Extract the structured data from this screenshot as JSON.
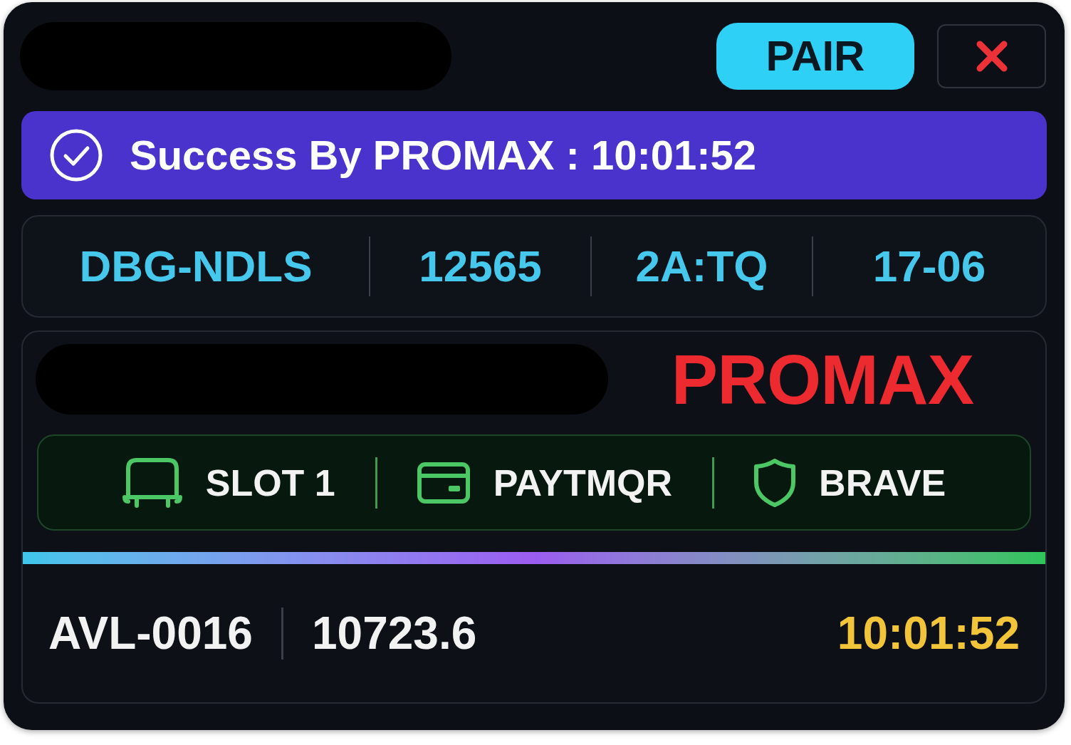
{
  "header": {
    "pair_button": "PAIR"
  },
  "banner": {
    "text": "Success By PROMAX : 10:01:52"
  },
  "info_row": [
    {
      "value": "DBG-NDLS"
    },
    {
      "value": "12565"
    },
    {
      "value": "2A:TQ"
    },
    {
      "value": "17-06"
    }
  ],
  "card": {
    "brand": "PROMAX",
    "details": [
      {
        "kind": "slot",
        "label": "SLOT 1"
      },
      {
        "kind": "payment",
        "label": "PAYTMQR"
      },
      {
        "kind": "browser",
        "label": "BRAVE"
      }
    ],
    "footer": {
      "id": "AVL-0016",
      "amount": "10723.6",
      "time": "10:01:52"
    }
  }
}
